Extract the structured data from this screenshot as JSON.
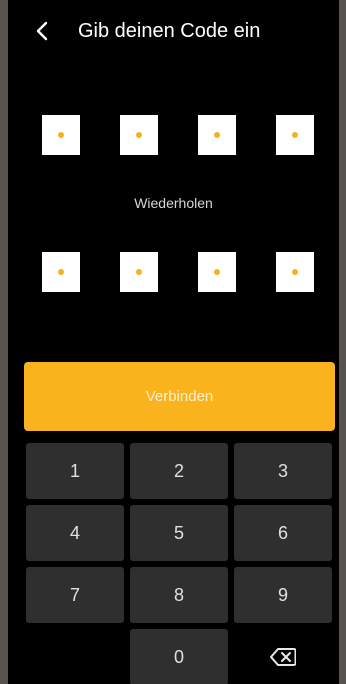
{
  "header": {
    "title": "Gib deinen Code ein",
    "back_icon": "chevron-left-icon"
  },
  "code": {
    "filled_digits": 0,
    "boxes_per_row": 4,
    "dot_color": "#f5b11c"
  },
  "repeat_label": "Wiederholen",
  "connect_button": {
    "label": "Verbinden",
    "color": "#f9b31d"
  },
  "keypad": {
    "keys": [
      "1",
      "2",
      "3",
      "4",
      "5",
      "6",
      "7",
      "8",
      "9",
      "0"
    ],
    "backspace_icon": "backspace-icon"
  }
}
